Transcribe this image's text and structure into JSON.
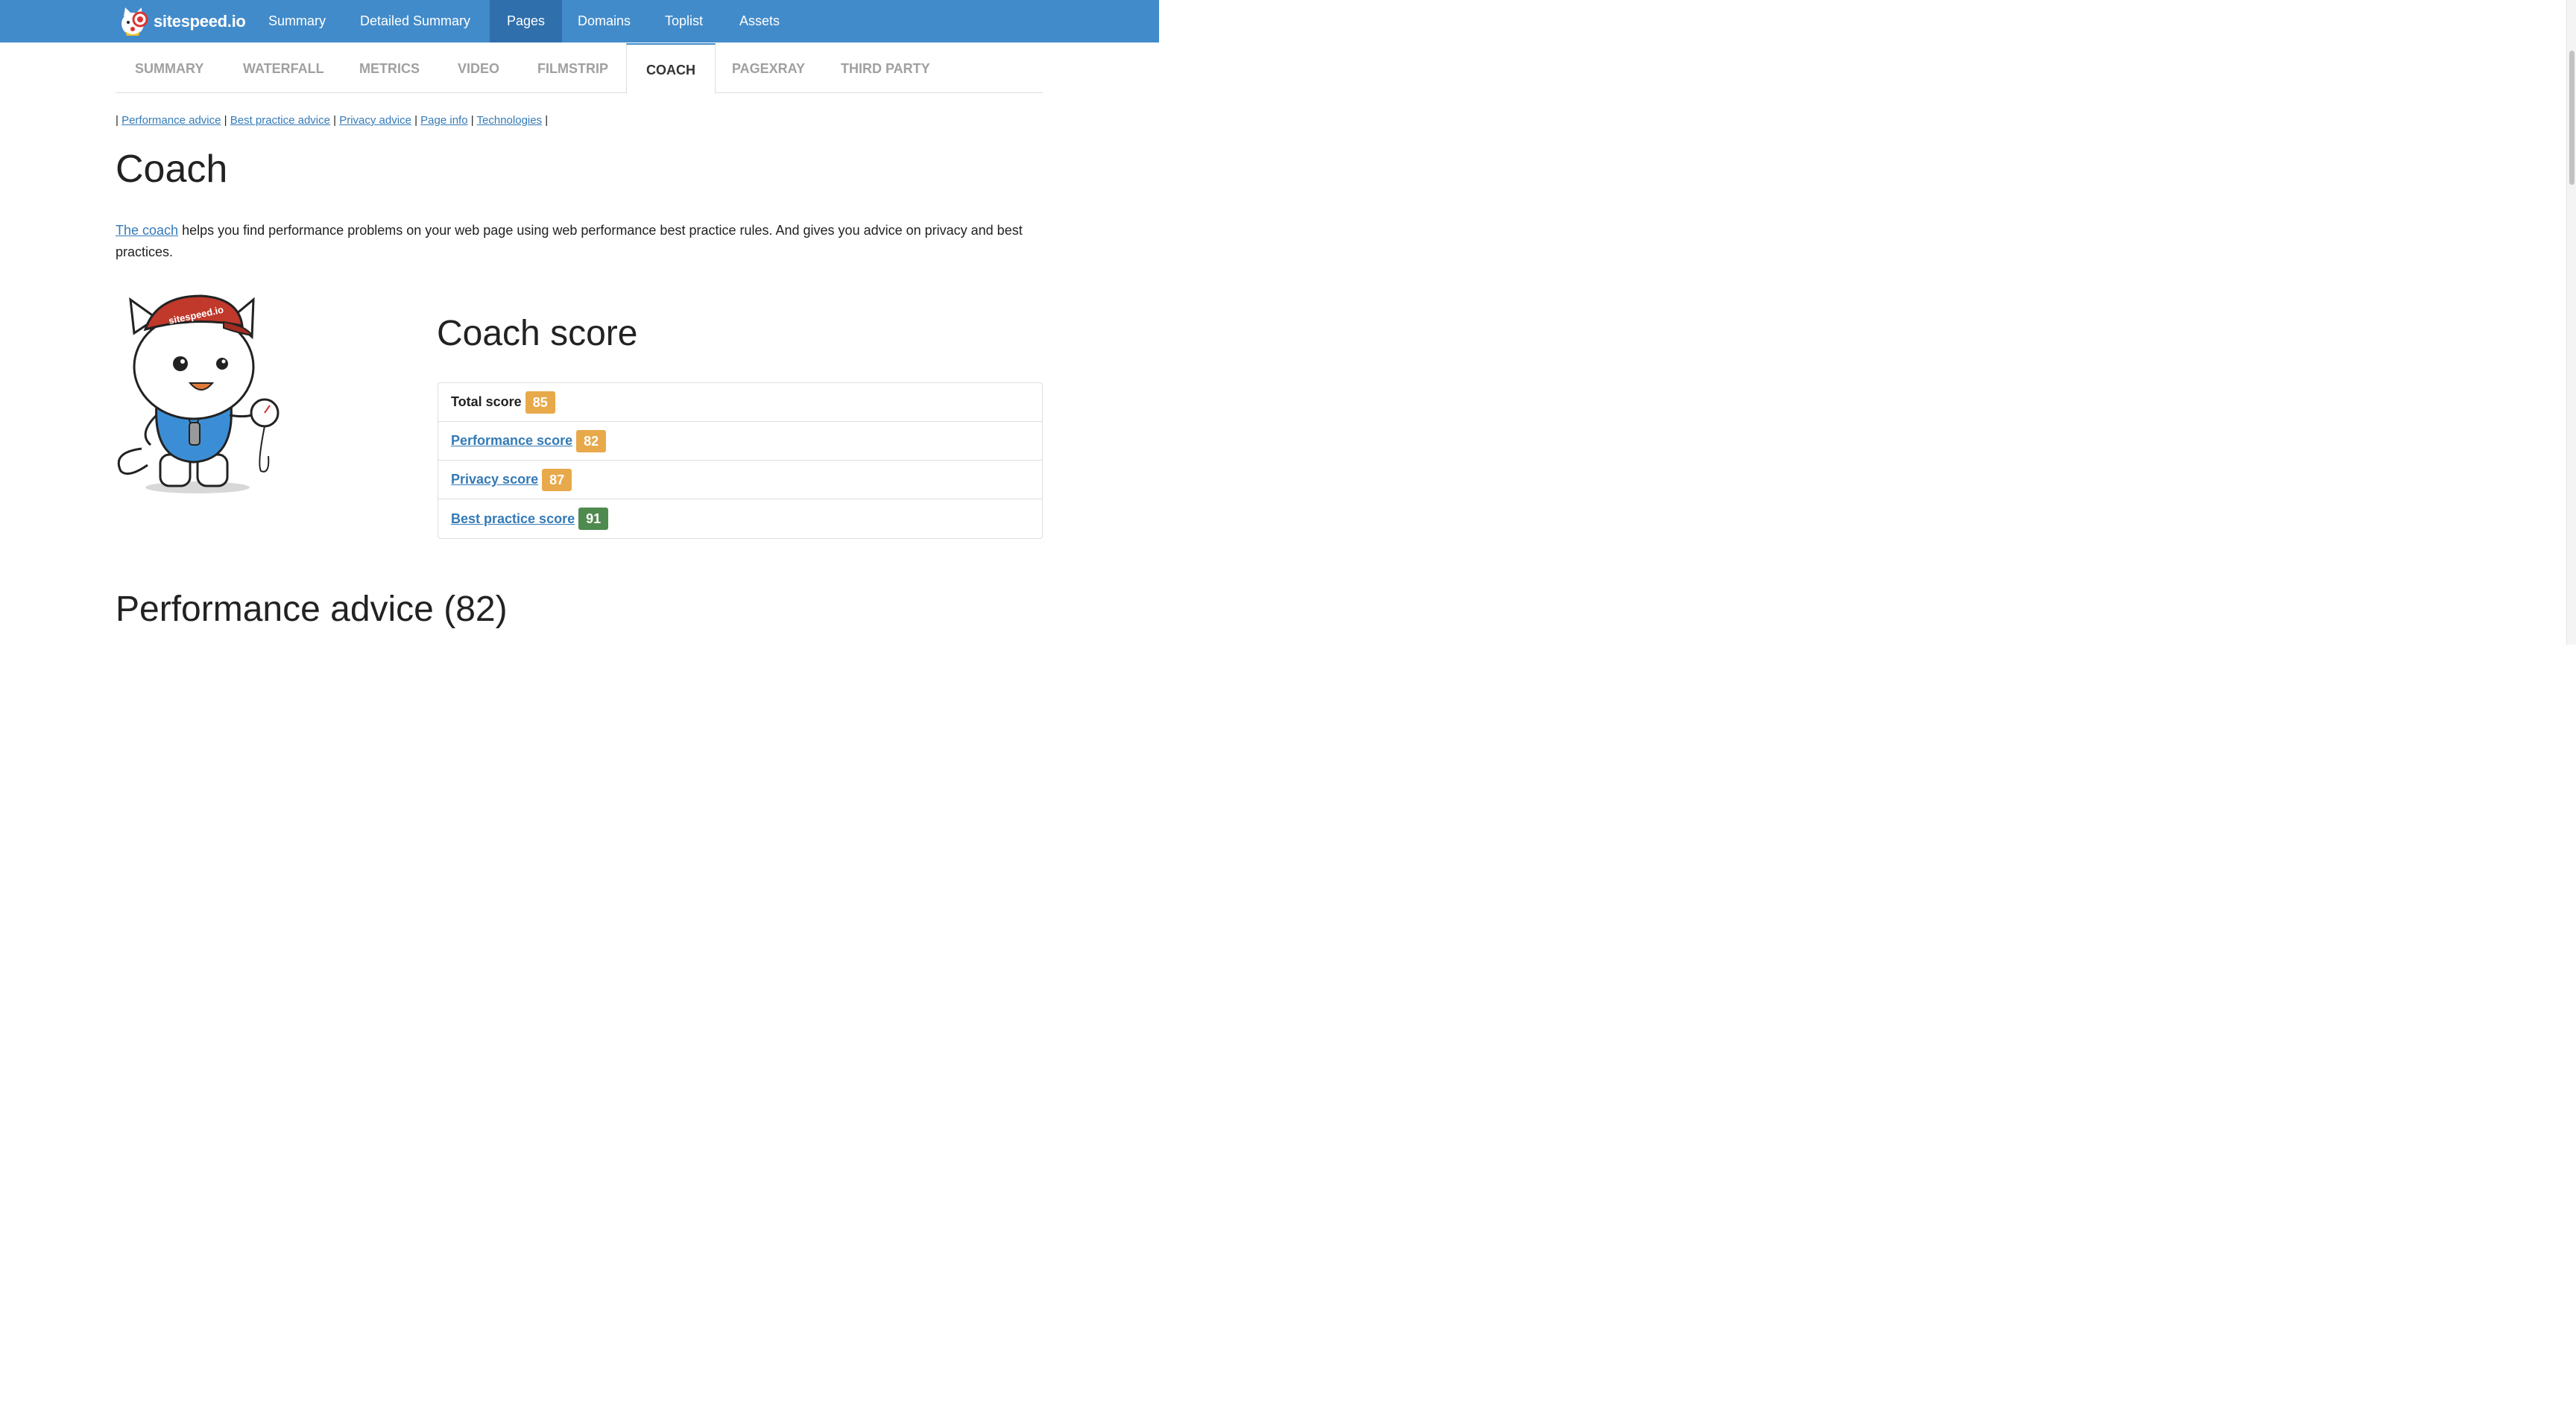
{
  "navbar": {
    "brand": "sitespeed.io",
    "items": [
      {
        "label": "Summary"
      },
      {
        "label": "Detailed Summary"
      },
      {
        "label": "Pages"
      },
      {
        "label": "Domains"
      },
      {
        "label": "Toplist"
      },
      {
        "label": "Assets"
      }
    ],
    "active": "Pages",
    "color": "#428bca"
  },
  "tabs": {
    "items": [
      {
        "label": "SUMMARY"
      },
      {
        "label": "WATERFALL"
      },
      {
        "label": "METRICS"
      },
      {
        "label": "VIDEO"
      },
      {
        "label": "FILMSTRIP"
      },
      {
        "label": "COACH"
      },
      {
        "label": "PAGEXRAY"
      },
      {
        "label": "THIRD PARTY"
      }
    ],
    "active": "COACH"
  },
  "subnav": {
    "links": [
      {
        "label": "Performance advice"
      },
      {
        "label": "Best practice advice"
      },
      {
        "label": "Privacy advice"
      },
      {
        "label": "Page info"
      },
      {
        "label": "Technologies"
      }
    ]
  },
  "page": {
    "title": "Coach",
    "intro_link": "The coach",
    "intro_text": " helps you find performance problems on your web page using web performance best practice rules. And gives you advice on privacy and best practices."
  },
  "mascot": {
    "cap_text": "sitespeed.io"
  },
  "coach_score": {
    "title": "Coach score",
    "rows": [
      {
        "label": "Total score",
        "value": "85",
        "color": "#e8a94a"
      },
      {
        "label": "Performance score",
        "value": "82",
        "color": "#e8a94a"
      },
      {
        "label": "Privacy score",
        "value": "87",
        "color": "#e8a94a"
      },
      {
        "label": "Best practice score",
        "value": "91",
        "color": "#4f8a4f"
      }
    ]
  },
  "performance_advice": {
    "title": "Performance advice (82)"
  }
}
